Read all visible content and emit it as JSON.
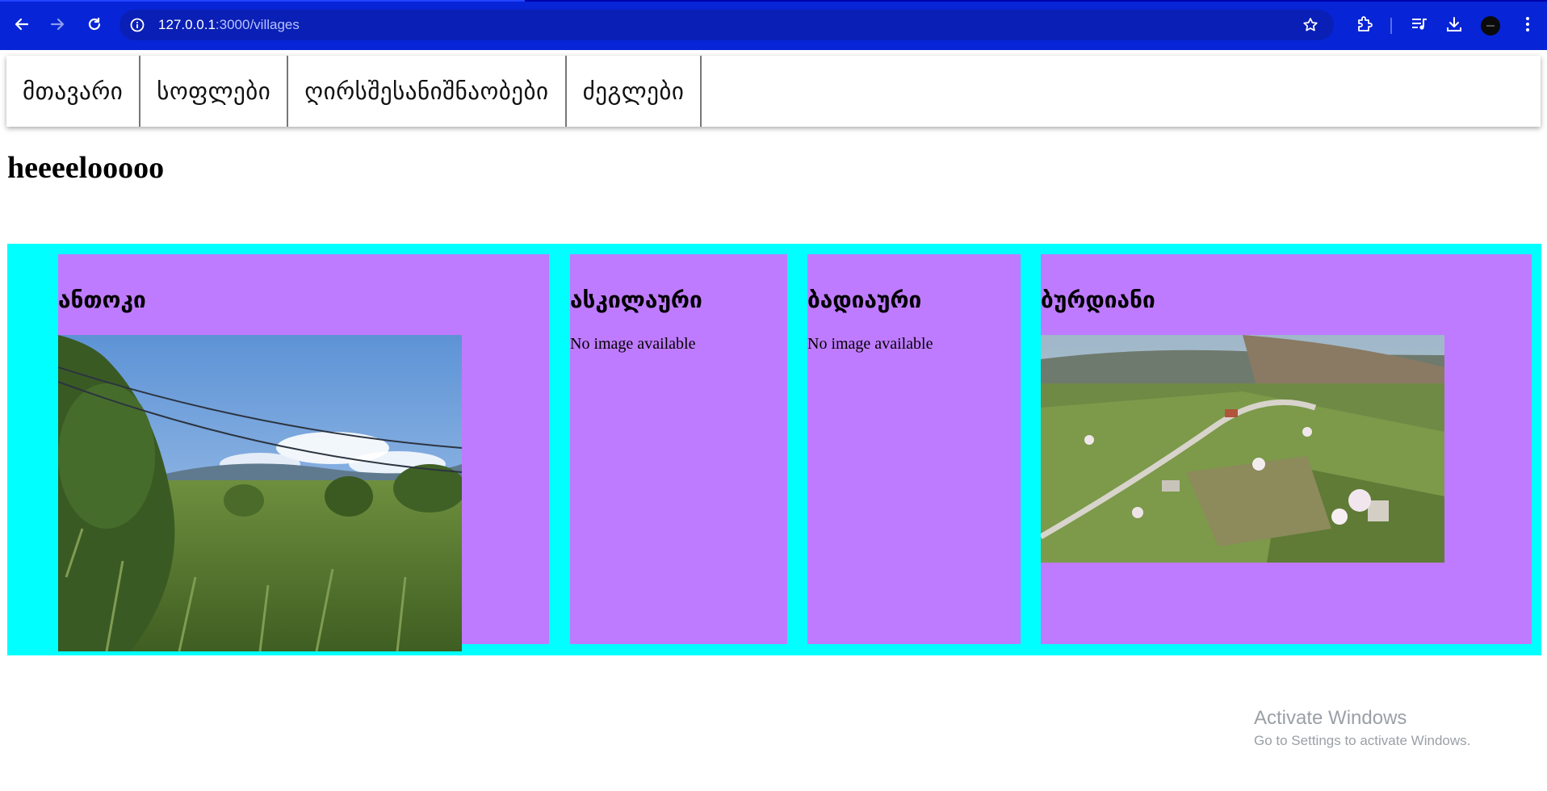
{
  "browser": {
    "url_host": "127.0.0.1",
    "url_path": ":3000/villages",
    "icons": [
      "back-icon",
      "forward-icon",
      "reload-icon",
      "site-info-icon",
      "bookmark-star-icon",
      "extensions-icon",
      "media-control-icon",
      "download-icon",
      "profile-avatar",
      "more-menu-icon"
    ]
  },
  "nav": {
    "items": [
      {
        "label": "მთავარი"
      },
      {
        "label": "სოფლები"
      },
      {
        "label": "ღირსშესანიშნაობები"
      },
      {
        "label": "ძეგლები"
      }
    ]
  },
  "page": {
    "title": "heeeelooooo"
  },
  "villages": [
    {
      "name": "ანთოკი",
      "image": "photo-meadow"
    },
    {
      "name": "ასკილაური",
      "no_image_text": "No image available"
    },
    {
      "name": "ბადიაური",
      "no_image_text": "No image available"
    },
    {
      "name": "ბურდიანი",
      "image": "photo-aerial-village"
    }
  ],
  "colors": {
    "chrome": "#0725d6",
    "grid_background": "#00ffff",
    "card_background": "#bf7bff"
  },
  "watermark": {
    "line1": "Activate Windows",
    "line2": "Go to Settings to activate Windows."
  }
}
